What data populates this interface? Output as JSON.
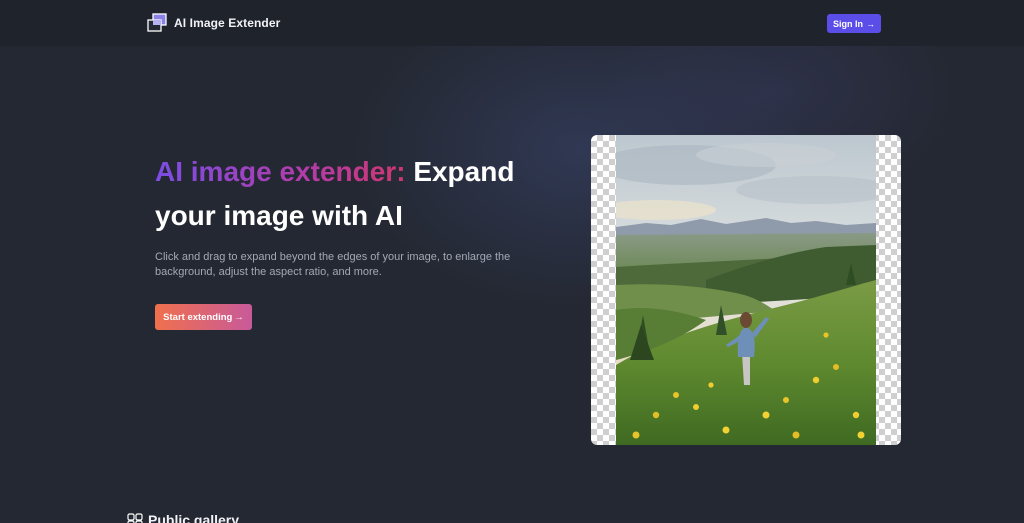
{
  "header": {
    "logo_icon": "overlapping-squares-icon",
    "app_title": "AI Image Extender",
    "signin_label": "Sign In",
    "signin_arrow": "→",
    "colors": {
      "header_bg": "#1f232c",
      "signin_bg": "#5b4de8"
    }
  },
  "hero": {
    "title_highlight": "AI image extender:",
    "title_rest": "Expand your image with AI",
    "description": "Click and drag to expand beyond the edges of your image, to enlarge the background, adjust the aspect ratio, and more.",
    "cta_label": "Start extending",
    "cta_arrow": "→",
    "colors": {
      "highlight_start": "#7c4de6",
      "highlight_end": "#d0376f",
      "cta_start": "#f0704d",
      "cta_end": "#c85a9a"
    }
  },
  "preview": {
    "image": "woman-in-wildflower-meadow-with-mountains",
    "background": "transparency-checkerboard"
  },
  "gallery": {
    "icon": "gallery-grid-icon",
    "title": "Public gallery"
  }
}
